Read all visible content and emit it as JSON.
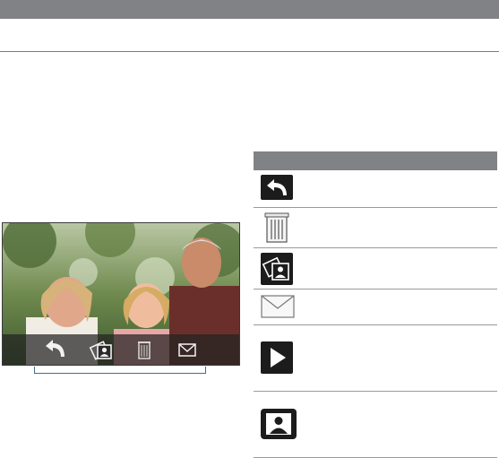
{
  "icons": {
    "back": "back-arrow-icon",
    "send_photo": "send-to-contact-icon",
    "delete": "trash-icon",
    "email": "envelope-icon",
    "play": "play-icon",
    "contact_picture": "contact-picture-icon"
  },
  "colors": {
    "header_bar": "#808285",
    "toolbar": "#232323",
    "bracket": "#3e6e96"
  }
}
